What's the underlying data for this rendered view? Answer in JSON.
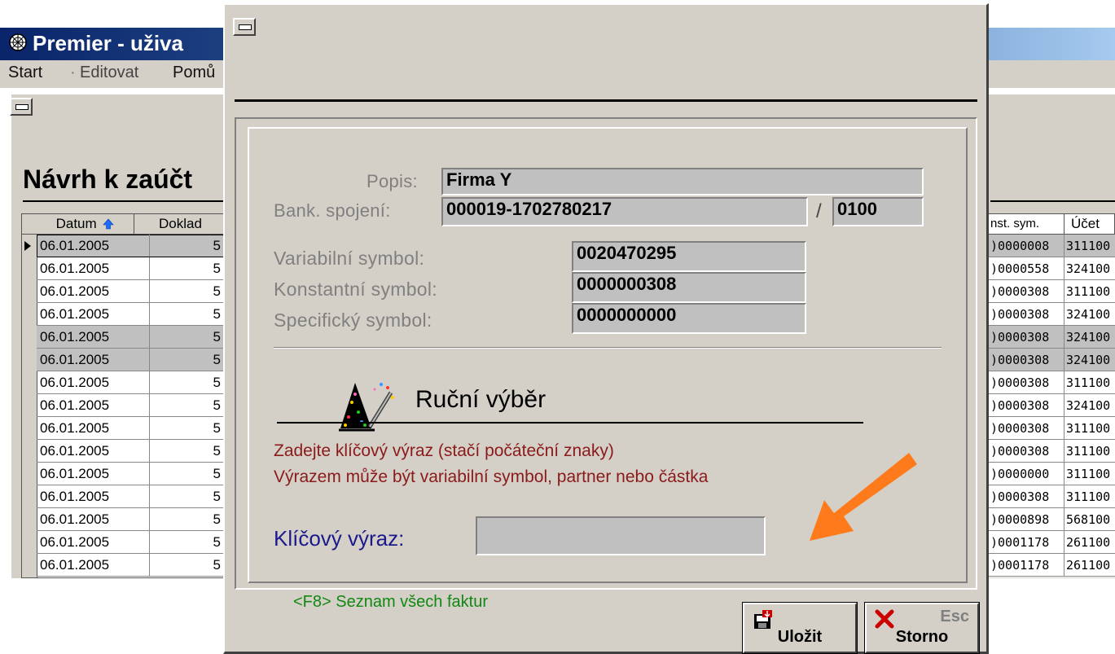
{
  "app": {
    "title": "Premier - uživa",
    "menu": [
      "Start",
      "Editovat",
      "Pomů"
    ]
  },
  "background": {
    "page_title": "Návrh k zaúčt",
    "grid_left": {
      "columns": [
        "Datum",
        "Doklad"
      ],
      "rows": [
        {
          "date": "06.01.2005",
          "doc": "5"
        },
        {
          "date": "06.01.2005",
          "doc": "5"
        },
        {
          "date": "06.01.2005",
          "doc": "5"
        },
        {
          "date": "06.01.2005",
          "doc": "5"
        },
        {
          "date": "06.01.2005",
          "doc": "5"
        },
        {
          "date": "06.01.2005",
          "doc": "5"
        },
        {
          "date": "06.01.2005",
          "doc": "5"
        },
        {
          "date": "06.01.2005",
          "doc": "5"
        },
        {
          "date": "06.01.2005",
          "doc": "5"
        },
        {
          "date": "06.01.2005",
          "doc": "5"
        },
        {
          "date": "06.01.2005",
          "doc": "5"
        },
        {
          "date": "06.01.2005",
          "doc": "5"
        },
        {
          "date": "06.01.2005",
          "doc": "5"
        },
        {
          "date": "06.01.2005",
          "doc": "5"
        },
        {
          "date": "06.01.2005",
          "doc": "5"
        }
      ]
    },
    "grid_right": {
      "columns": [
        "nst. sym.",
        "Účet"
      ],
      "rows": [
        {
          "ks": ")0000008",
          "acct": "311100"
        },
        {
          "ks": ")0000558",
          "acct": "324100"
        },
        {
          "ks": ")0000308",
          "acct": "311100"
        },
        {
          "ks": ")0000308",
          "acct": "324100"
        },
        {
          "ks": ")0000308",
          "acct": "324100"
        },
        {
          "ks": ")0000308",
          "acct": "324100"
        },
        {
          "ks": ")0000308",
          "acct": "311100"
        },
        {
          "ks": ")0000308",
          "acct": "324100"
        },
        {
          "ks": ")0000308",
          "acct": "311100"
        },
        {
          "ks": ")0000308",
          "acct": "311100"
        },
        {
          "ks": ")0000000",
          "acct": "311100"
        },
        {
          "ks": ")0000308",
          "acct": "311100"
        },
        {
          "ks": ")0000898",
          "acct": "568100"
        },
        {
          "ks": ")0001178",
          "acct": "261100"
        },
        {
          "ks": ")0001178",
          "acct": "261100"
        }
      ]
    }
  },
  "dialog": {
    "popis_label": "Popis:",
    "popis_value": "Firma Y",
    "bank_label": "Bank. spojení:",
    "bank_account": "000019-1702780217",
    "bank_sep": "/",
    "bank_code": "0100",
    "vs_label": "Variabilní symbol:",
    "vs_value": "0020470295",
    "ks_label": "Konstantní symbol:",
    "ks_value": "0000000308",
    "ss_label": "Specifický symbol:",
    "ss_value": "0000000000",
    "manual_title": "Ruční výběr",
    "hint1": "Zadejte klíčový výraz (stačí počáteční znaky)",
    "hint2": "Výrazem může být variabilní symbol, partner nebo částka",
    "key_label": "Klíčový výraz:",
    "key_value": "",
    "f8_hint": "<F8> Seznam všech faktur",
    "save_label": "Uložit",
    "cancel_label": "Storno",
    "cancel_shortcut": "Esc"
  },
  "colors": {
    "hint_text": "#8b1a1a",
    "key_label": "#1a1a8c",
    "f8_text": "#118811",
    "arrow": "#ff7a1a"
  }
}
